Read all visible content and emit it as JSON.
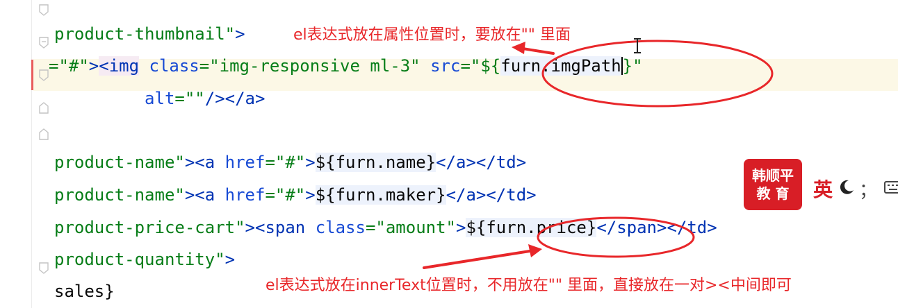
{
  "editor": {
    "lines": [
      {
        "segments": [
          {
            "text": "product-thumbnail\"",
            "cls": "str"
          },
          {
            "text": ">",
            "cls": "tag"
          }
        ]
      },
      {
        "segments": [
          {
            "text": "=\"#\"",
            "cls": "str"
          },
          {
            "text": ">",
            "cls": "tag"
          },
          {
            "text": "<img",
            "cls": "tag tagbg"
          },
          {
            "text": " class",
            "cls": "attr"
          },
          {
            "text": "=\"img-responsive ml-3\"",
            "cls": "str"
          },
          {
            "text": " src",
            "cls": "attr"
          },
          {
            "text": "=\"",
            "cls": "str"
          },
          {
            "text": "${",
            "cls": "str"
          },
          {
            "text": "furn.imgPath",
            "cls": "plain elbg"
          },
          {
            "text": "}",
            "cls": "str"
          },
          {
            "text": "\"",
            "cls": "str"
          }
        ]
      },
      {
        "segments": [
          {
            "text": "         alt",
            "cls": "attr"
          },
          {
            "text": "=\"\"",
            "cls": "str"
          },
          {
            "text": "/></a>",
            "cls": "tag"
          }
        ]
      },
      {
        "segments": []
      },
      {
        "segments": [
          {
            "text": "product-name\"",
            "cls": "str"
          },
          {
            "text": "><a",
            "cls": "tag"
          },
          {
            "text": " href",
            "cls": "attr"
          },
          {
            "text": "=\"#\"",
            "cls": "str"
          },
          {
            "text": ">",
            "cls": "tag"
          },
          {
            "text": "${",
            "cls": "plain elbg"
          },
          {
            "text": "furn.name",
            "cls": "plain elbg"
          },
          {
            "text": "}",
            "cls": "plain elbg"
          },
          {
            "text": "</a></td>",
            "cls": "tag"
          }
        ]
      },
      {
        "segments": [
          {
            "text": "product-name\"",
            "cls": "str"
          },
          {
            "text": "><a",
            "cls": "tag"
          },
          {
            "text": " href",
            "cls": "attr"
          },
          {
            "text": "=\"#\"",
            "cls": "str"
          },
          {
            "text": ">",
            "cls": "tag"
          },
          {
            "text": "${",
            "cls": "plain elbg"
          },
          {
            "text": "furn.maker",
            "cls": "plain elbg"
          },
          {
            "text": "}",
            "cls": "plain elbg"
          },
          {
            "text": "</a></td>",
            "cls": "tag"
          }
        ]
      },
      {
        "segments": [
          {
            "text": "product-price-cart\"",
            "cls": "str"
          },
          {
            "text": "><span",
            "cls": "tag"
          },
          {
            "text": " class",
            "cls": "attr"
          },
          {
            "text": "=\"amount\"",
            "cls": "str"
          },
          {
            "text": ">",
            "cls": "tag"
          },
          {
            "text": "${",
            "cls": "plain elbg"
          },
          {
            "text": "furn.price",
            "cls": "plain elbg"
          },
          {
            "text": "}",
            "cls": "plain elbg"
          },
          {
            "text": "</span></td>",
            "cls": "tag"
          }
        ]
      },
      {
        "segments": [
          {
            "text": "product-quantity\"",
            "cls": "str"
          },
          {
            "text": ">",
            "cls": "tag"
          }
        ]
      },
      {
        "segments": [
          {
            "text": "sales}",
            "cls": "plain"
          }
        ]
      }
    ]
  },
  "annotations": {
    "top": "el表达式放在属性位置时，要放在\"\" 里面",
    "bottom": "el表达式放在innerText位置时，不用放在\"\" 里面，直接放在一对><中间即可"
  },
  "overlay": {
    "logo_line1": "韩顺平",
    "logo_line2": "教 育",
    "ime_lang": "英",
    "ime_punct": "；"
  },
  "colors": {
    "annotation": "#e8272a",
    "string": "#067d17",
    "tag": "#0033b3",
    "attribute": "#174ad4"
  }
}
